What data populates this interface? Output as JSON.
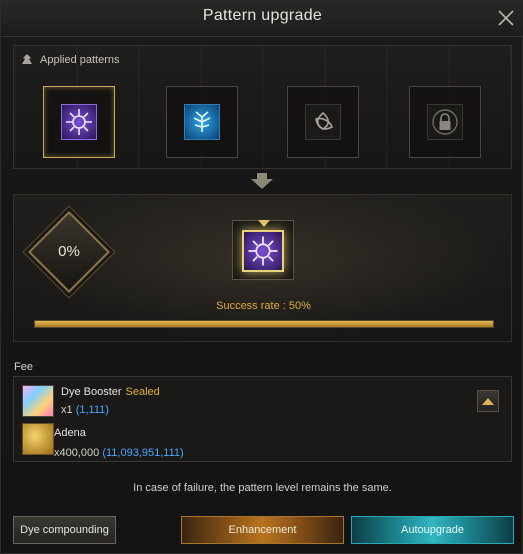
{
  "window": {
    "title": "Pattern upgrade"
  },
  "applied": {
    "label": "Applied patterns",
    "slots": [
      {
        "icon": "purple-crest-pattern-icon",
        "state": "selected"
      },
      {
        "icon": "blue-crest-pattern-icon",
        "state": "available"
      },
      {
        "icon": "triquetra-pattern-icon",
        "state": "empty"
      },
      {
        "icon": "lock-icon",
        "state": "locked"
      }
    ]
  },
  "upgrade": {
    "chance_text": "0%",
    "success_rate": "Success rate : 50%",
    "progress": 1.0
  },
  "fee": {
    "label": "Fee",
    "items": [
      {
        "name": "Dye Booster",
        "tag": "Sealed",
        "qty": "x1",
        "owned": "(1,111)",
        "icon": "dye-booster-icon"
      },
      {
        "name": "Adena",
        "tag": "",
        "qty": "x400,000",
        "owned": "(11,093,951,111)",
        "icon": "adena-coins-icon"
      }
    ]
  },
  "note": "In case of failure, the pattern level remains the same.",
  "buttons": {
    "dye_compounding": "Dye compounding",
    "enhancement": "Enhancement",
    "autoupgrade": "Autoupgrade"
  },
  "colors": {
    "accent_gold": "#e0a93c",
    "owned_blue": "#4aa6ff",
    "autoupgrade_teal": "#33b6c0"
  }
}
